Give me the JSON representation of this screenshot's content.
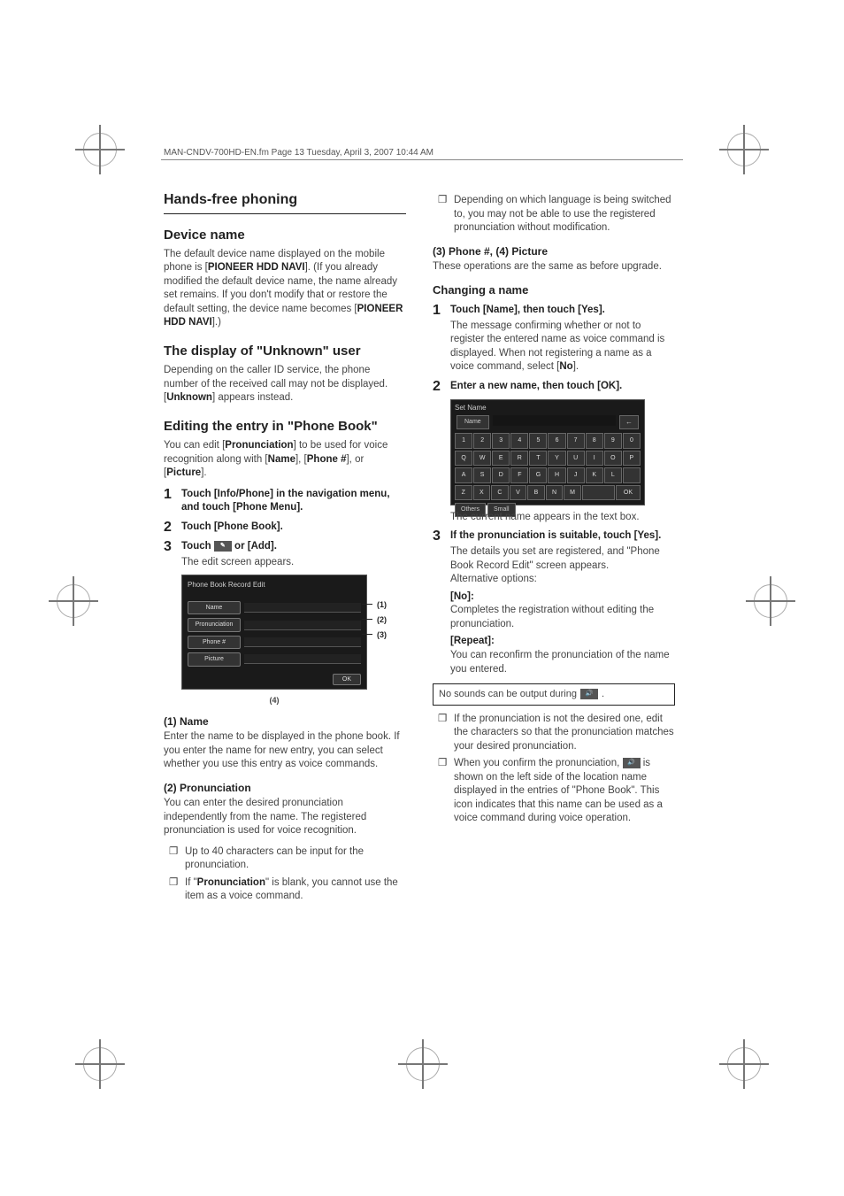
{
  "header": "MAN-CNDV-700HD-EN.fm  Page 13  Tuesday, April 3, 2007  10:44 AM",
  "left": {
    "chapter": "Hands-free phoning",
    "s1": {
      "title": "Device name",
      "p1a": "The default device name displayed on the mobile phone is [",
      "p1b": "PIONEER HDD NAVI",
      "p1c": "]. (If you already modified the default device name, the name already set remains. If you don't modify that or restore the default setting, the device name becomes [",
      "p1d": "PIONEER HDD NAVI",
      "p1e": "].)"
    },
    "s2": {
      "title": "The display of \"Unknown\" user",
      "p1a": "Depending on the caller ID service, the phone number of the received call may not be displayed. [",
      "p1b": "Unknown",
      "p1c": "] appears instead."
    },
    "s3": {
      "title": "Editing the entry in \"Phone Book\"",
      "p1a": "You can edit [",
      "p1b": "Pronunciation",
      "p1c": "] to be used for voice recognition along with [",
      "p1d": "Name",
      "p1e": "], [",
      "p1f": "Phone #",
      "p1g": "], or [",
      "p1h": "Picture",
      "p1i": "].",
      "step1": "Touch [Info/Phone] in the navigation menu, and touch [Phone Menu].",
      "step2": "Touch [Phone Book].",
      "step3a": "Touch ",
      "step3b": " or [Add].",
      "step3body": "The edit screen appears.",
      "fig": {
        "title": "Phone Book Record Edit",
        "rows": [
          "Name",
          "Pronunciation",
          "Phone #",
          "Picture"
        ],
        "ok": "OK",
        "markers": [
          "(1)",
          "(2)",
          "(3)",
          "(4)"
        ]
      },
      "sub1": {
        "h": "(1) Name",
        "p": "Enter the name to be displayed in the phone book. If you enter the name for new entry, you can select whether you use this entry as voice commands."
      },
      "sub2": {
        "h": "(2) Pronunciation",
        "p": "You can enter the desired pronunciation independently from the name. The registered pronunciation is used for voice recognition.",
        "b1": "Up to 40 characters can be input for the pronunciation.",
        "b2a": "If \"",
        "b2b": "Pronunciation",
        "b2c": "\" is blank, you cannot use the item as a voice command."
      }
    }
  },
  "right": {
    "b1": "Depending on which language is being switched to, you may not be able to use the registered pronunciation without modification.",
    "sub3": {
      "h": "(3) Phone #, (4) Picture",
      "p": "These operations are the same as before upgrade."
    },
    "changing": {
      "h": "Changing a name",
      "step1": "Touch [Name], then touch [Yes].",
      "step1ba": "The message confirming whether or not to register the entered name as voice command is displayed. When not registering a name as a voice command, select [",
      "step1bb": "No",
      "step1bc": "].",
      "step2": "Enter a new name, then touch [OK].",
      "fig": {
        "title": "Set Name",
        "name": "Name",
        "back": "←",
        "rows": [
          [
            "1",
            "2",
            "3",
            "4",
            "5",
            "6",
            "7",
            "8",
            "9",
            "0"
          ],
          [
            "Q",
            "W",
            "E",
            "R",
            "T",
            "Y",
            "U",
            "I",
            "O",
            "P"
          ],
          [
            "A",
            "S",
            "D",
            "F",
            "G",
            "H",
            "J",
            "K",
            "L",
            ""
          ],
          [
            "Z",
            "X",
            "C",
            "V",
            "B",
            "N",
            "M",
            "",
            ""
          ]
        ],
        "ok": "OK",
        "others": "Others",
        "small": "Small"
      },
      "step2body": "The current name appears in the text box.",
      "step3": "If the pronunciation is suitable, touch [Yes].",
      "step3b1": "The details you set are registered, and \"Phone Book Record Edit\" screen appears.",
      "step3b2": "Alternative options:",
      "no_h": "[No]:",
      "no_p": "Completes the registration without editing the pronunciation.",
      "rep_h": "[Repeat]:",
      "rep_p": "You can reconfirm the pronunciation of the name you entered.",
      "note": "No sounds can be output during ",
      "b2": "If the pronunciation is not the desired one, edit the characters so that the pronunciation matches your desired pronunciation.",
      "b3a": "When you confirm the pronunciation, ",
      "b3b": " is shown on the left side of the location name displayed in the entries of \"Phone Book\". This icon indicates that this name can be used as a voice command during voice operation."
    }
  }
}
